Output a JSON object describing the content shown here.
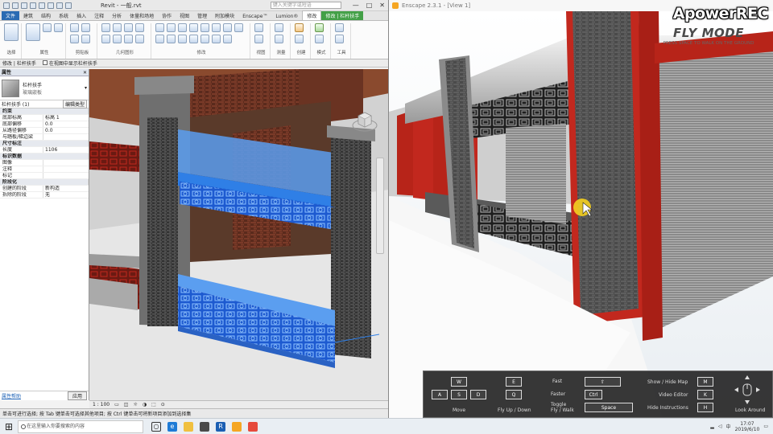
{
  "revit": {
    "title": "Revit - 一般.rvt",
    "search_placeholder": "键入关键字或短语",
    "window_controls": [
      "—",
      "□",
      "✕"
    ],
    "tabs": [
      {
        "label": "文件",
        "state": "file"
      },
      {
        "label": "建筑",
        "state": ""
      },
      {
        "label": "结构",
        "state": ""
      },
      {
        "label": "系统",
        "state": ""
      },
      {
        "label": "插入",
        "state": ""
      },
      {
        "label": "注释",
        "state": ""
      },
      {
        "label": "分析",
        "state": ""
      },
      {
        "label": "体量和场地",
        "state": ""
      },
      {
        "label": "协作",
        "state": ""
      },
      {
        "label": "视图",
        "state": ""
      },
      {
        "label": "管理",
        "state": ""
      },
      {
        "label": "附加模块",
        "state": ""
      },
      {
        "label": "Enscape™",
        "state": ""
      },
      {
        "label": "Lumion®",
        "state": ""
      },
      {
        "label": "修改",
        "state": "active"
      },
      {
        "label": "修改 | 栏杆扶手",
        "state": "context"
      }
    ],
    "ribbon_groups": [
      {
        "label": "选择",
        "tools": [
          "big"
        ]
      },
      {
        "label": "属性",
        "tools": [
          "big",
          "",
          ""
        ]
      },
      {
        "label": "剪贴板",
        "tools": [
          "",
          "",
          "",
          ""
        ]
      },
      {
        "label": "几何图形",
        "tools": [
          "",
          "",
          "",
          "",
          "",
          "",
          "",
          ""
        ]
      },
      {
        "label": "修改",
        "tools": [
          "",
          "",
          "",
          "",
          "",
          "",
          "",
          "",
          "",
          "",
          "",
          "",
          "",
          "",
          ""
        ]
      },
      {
        "label": "视图",
        "tools": [
          "",
          ""
        ]
      },
      {
        "label": "测量",
        "tools": [
          "",
          ""
        ]
      },
      {
        "label": "创建",
        "tools": [
          "orange",
          ""
        ]
      },
      {
        "label": "模式",
        "tools": [
          "green",
          ""
        ]
      },
      {
        "label": "工具",
        "tools": [
          "",
          ""
        ]
      }
    ],
    "options_bar": {
      "label": "修改 | 栏杆扶手",
      "checkbox_label": "在视图中显示栏杆扶手"
    },
    "properties": {
      "header": "属性",
      "type_name": "栏杆扶手",
      "type_sub": "玻璃嵌板",
      "instance_label": "栏杆扶手 (1)",
      "edit_type": "编辑类型",
      "rows": [
        {
          "k": "约束",
          "v": "",
          "section": true
        },
        {
          "k": "底部标高",
          "v": "标高 1",
          "section": false
        },
        {
          "k": "底部偏移",
          "v": "0.0",
          "section": false
        },
        {
          "k": "从路径偏移",
          "v": "0.0",
          "section": false
        },
        {
          "k": "与踏板/梯边梁",
          "v": "",
          "section": false
        },
        {
          "k": "尺寸标注",
          "v": "",
          "section": true
        },
        {
          "k": "长度",
          "v": "1106",
          "section": false
        },
        {
          "k": "标识数据",
          "v": "",
          "section": true
        },
        {
          "k": "图像",
          "v": "",
          "section": false
        },
        {
          "k": "注释",
          "v": "",
          "section": false
        },
        {
          "k": "标记",
          "v": "",
          "section": false
        },
        {
          "k": "阶段化",
          "v": "",
          "section": true
        },
        {
          "k": "创建的阶段",
          "v": "新构造",
          "section": false
        },
        {
          "k": "拆除的阶段",
          "v": "无",
          "section": false
        }
      ],
      "help": "属性帮助",
      "apply": "应用"
    },
    "view_control": "1 : 100",
    "status": "单击可进行选择; 按 Tab 键单击可选择其他项目; 按 Ctrl 键单击可将新项目添加到选择集"
  },
  "enscape": {
    "title": "Enscape 2.3.1 - [View 1]"
  },
  "watermark": {
    "brand": "ApowerREC"
  },
  "flymode": {
    "title": "FLY MODE",
    "hint": "PRESS SPACE TO WALK ON THE GROUND"
  },
  "instructions": {
    "move_keys": [
      "W",
      "A",
      "S",
      "D"
    ],
    "move_label": "Move",
    "fly_keys": [
      "E",
      "Q"
    ],
    "fly_label": "Fly Up / Down",
    "fast_label": "Fast",
    "fast_key": "⇧",
    "faster_label": "Faster",
    "faster_key": "Ctrl",
    "toggle_label": "Toggle\nFly / Walk",
    "toggle_key": "Space",
    "minimap_label": "Show / Hide Map",
    "minimap_key": "M",
    "video_label": "Video Editor",
    "video_key": "K",
    "hide_label": "Hide Instructions",
    "hide_key": "H",
    "look_label": "Look Around"
  },
  "taskbar": {
    "search_placeholder": "在这里输入你要搜索的内容",
    "time": "17:07",
    "date": "2019/6/10",
    "ime": "中"
  },
  "colors": {
    "selection_blue": "#2f7fe6",
    "pillar_red": "#c2281e",
    "enscape_accent": "#f5a623"
  }
}
